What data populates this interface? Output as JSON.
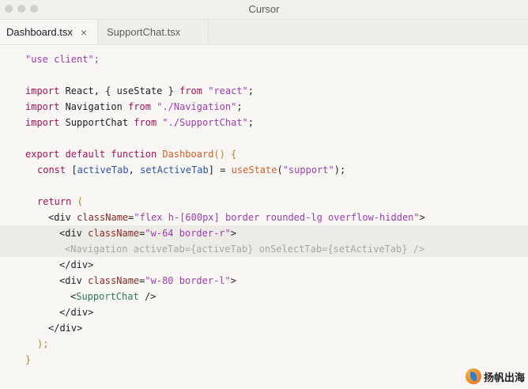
{
  "window": {
    "title": "Cursor"
  },
  "tabs": [
    {
      "label": "Dashboard.tsx",
      "close_glyph": "×"
    },
    {
      "label": "SupportChat.tsx"
    }
  ],
  "code": {
    "l1": "\"use client\";",
    "l3_import": "import",
    "l3_mid": " React, { useState } ",
    "l3_from": "from",
    "l3_str": " \"react\"",
    "l3_end": ";",
    "l4_import": "import",
    "l4_mid": " Navigation ",
    "l4_from": "from",
    "l4_str": " \"./Navigation\"",
    "l4_end": ";",
    "l5_import": "import",
    "l5_mid": " SupportChat ",
    "l5_from": "from",
    "l5_str": " \"./SupportChat\"",
    "l5_end": ";",
    "l7_export": "export default function",
    "l7_name": " Dashboard",
    "l7_rest": "() {",
    "l8_const": "const",
    "l8_open": " [",
    "l8_a": "activeTab",
    "l8_sep": ", ",
    "l8_b": "setActiveTab",
    "l8_close": "] = ",
    "l8_fn": "useState",
    "l8_p1": "(",
    "l8_str": "\"support\"",
    "l8_p2": ");",
    "l10_return": "return",
    "l10_paren": " (",
    "l11_tag": "<div",
    "l11_attr": " className",
    "l11_eq": "=",
    "l11_str": "\"flex h-[600px] border rounded-lg overflow-hidden\"",
    "l11_end": ">",
    "l12_tag": "<div",
    "l12_attr": " className",
    "l12_eq": "=",
    "l12_str": "\"w-64 border-r\"",
    "l12_end": ">",
    "l13": "<Navigation activeTab={activeTab} onSelectTab={setActiveTab} />",
    "l14": "</div>",
    "l15_tag": "<div",
    "l15_attr": " className",
    "l15_eq": "=",
    "l15_str": "\"w-80 border-l\"",
    "l15_end": ">",
    "l16_open": "<",
    "l16_comp": "SupportChat",
    "l16_close": " />",
    "l17": "</div>",
    "l18": "</div>",
    "l19": ");",
    "l20": "}"
  },
  "watermark": {
    "text": "扬帆出海",
    "icon": "sail-logo-icon"
  }
}
